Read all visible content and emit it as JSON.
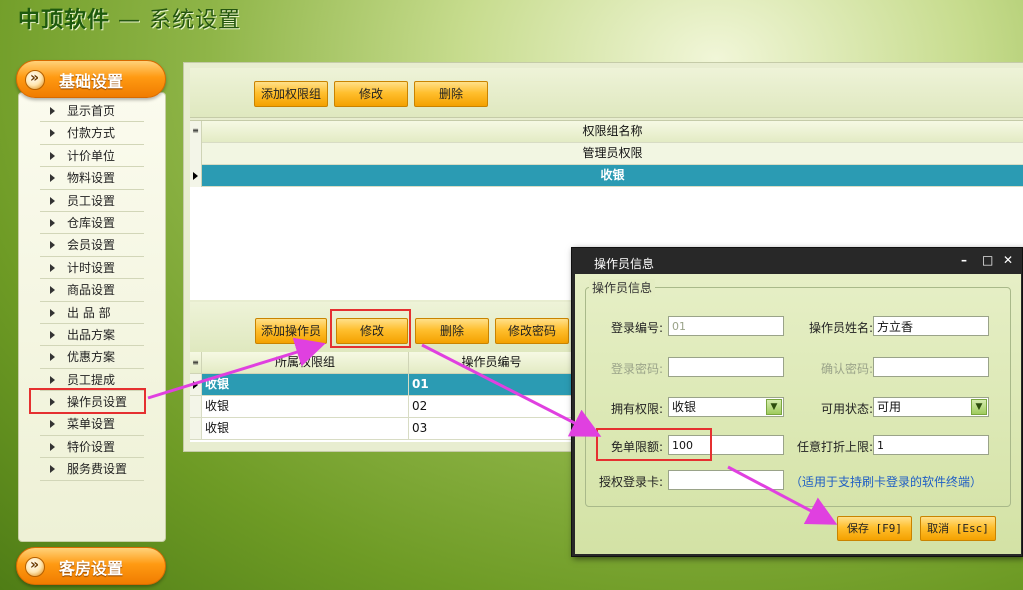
{
  "app": {
    "brand": "中顶软件",
    "separator": " — ",
    "section_title": "系统设置"
  },
  "sidebar": {
    "top_header": "基础设置",
    "bottom_header": "客房设置",
    "items": [
      {
        "label": "显示首页"
      },
      {
        "label": "付款方式"
      },
      {
        "label": "计价单位"
      },
      {
        "label": "物料设置"
      },
      {
        "label": "员工设置"
      },
      {
        "label": "仓库设置"
      },
      {
        "label": "会员设置"
      },
      {
        "label": "计时设置"
      },
      {
        "label": "商品设置"
      },
      {
        "label": "出 品 部"
      },
      {
        "label": "出品方案"
      },
      {
        "label": "优惠方案"
      },
      {
        "label": "员工提成"
      },
      {
        "label": "操作员设置"
      },
      {
        "label": "菜单设置"
      },
      {
        "label": "特价设置"
      },
      {
        "label": "服务费设置"
      }
    ],
    "highlight_color": "#e53030"
  },
  "permission_toolbar": {
    "add_label": "添加权限组",
    "edit_label": "修改",
    "delete_label": "删除"
  },
  "permission_grid": {
    "header": "权限组名称",
    "rows": [
      "管理员权限",
      "收银"
    ],
    "selected_row": "收银"
  },
  "operator_toolbar": {
    "add_label": "添加操作员",
    "edit_label": "修改",
    "delete_label": "删除",
    "change_pwd_label": "修改密码"
  },
  "operator_grid": {
    "headers": [
      "所属权限组",
      "操作员编号"
    ],
    "rows": [
      {
        "group": "收银",
        "id": "01"
      },
      {
        "group": "收银",
        "id": "02"
      },
      {
        "group": "收银",
        "id": "03"
      }
    ]
  },
  "dialog": {
    "title": "操作员信息",
    "minimize": "–",
    "maximize": "□",
    "close": "✕",
    "group_legend": "操作员信息",
    "login_id_label": "登录编号:",
    "login_id_value": "01",
    "operator_name_label": "操作员姓名:",
    "operator_name_value": "方立香",
    "login_pwd_label": "登录密码:",
    "login_pwd_value": "",
    "confirm_pwd_label": "确认密码:",
    "confirm_pwd_value": "",
    "permission_label": "拥有权限:",
    "permission_value": "收银",
    "status_label": "可用状态:",
    "status_value": "可用",
    "free_limit_label": "免单限额:",
    "free_limit_value": "100",
    "discount_limit_label": "任意打折上限:",
    "discount_limit_value": "1",
    "auth_card_label": "授权登录卡:",
    "auth_card_value": "",
    "auth_card_note": "（适用于支持刷卡登录的软件终端）",
    "save_label": "保存 [F9]",
    "cancel_label": "取消 [Esc]"
  },
  "annotation": {
    "arrow_color": "#e040e0",
    "box_color": "#e53030"
  }
}
